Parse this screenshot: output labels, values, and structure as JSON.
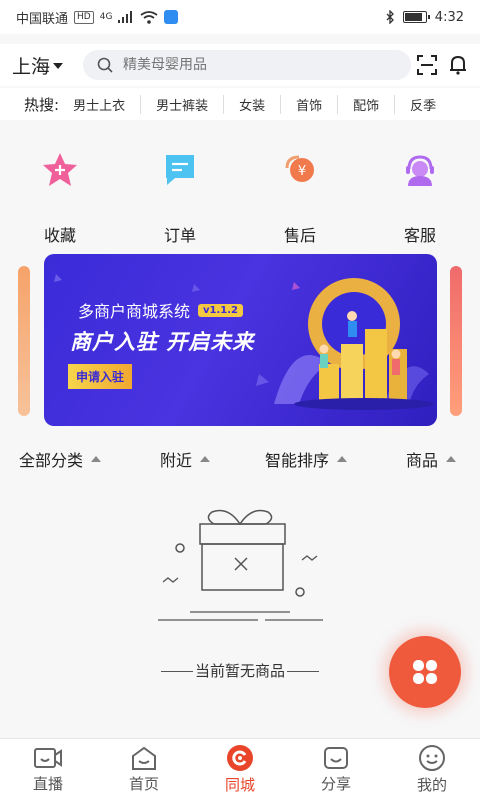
{
  "status": {
    "carrier": "中国联通",
    "net_badge": "HD",
    "net_type": "4G",
    "time": "4:32",
    "battery_level": 0.9
  },
  "header": {
    "city": "上海",
    "search_placeholder": "精美母婴用品"
  },
  "hot_search": {
    "label": "热搜:",
    "tags": [
      "男士上衣",
      "男士裤装",
      "女装",
      "首饰",
      "配饰",
      "反季"
    ]
  },
  "quick_links": [
    {
      "label": "收藏",
      "icon": "star-icon",
      "color": "#f0609a"
    },
    {
      "label": "订单",
      "icon": "order-icon",
      "color": "#4cc3f0"
    },
    {
      "label": "售后",
      "icon": "after-sale-icon",
      "color": "#f07a4c"
    },
    {
      "label": "客服",
      "icon": "customer-service-icon",
      "color": "#b06af0"
    }
  ],
  "banner": {
    "title": "多商户商城系统",
    "version": "v1.1.2",
    "slogan": "商户入驻  开启未来",
    "button": "申请入驻"
  },
  "filters": [
    {
      "label": "全部分类"
    },
    {
      "label": "附近"
    },
    {
      "label": "智能排序"
    },
    {
      "label": "商品"
    }
  ],
  "empty_state": {
    "text": "当前暂无商品"
  },
  "bottom_nav": [
    {
      "label": "直播",
      "icon": "live-icon",
      "active": false
    },
    {
      "label": "首页",
      "icon": "home-icon",
      "active": false
    },
    {
      "label": "同城",
      "icon": "local-city-icon",
      "active": true
    },
    {
      "label": "分享",
      "icon": "share-icon",
      "active": false
    },
    {
      "label": "我的",
      "icon": "profile-icon",
      "active": false
    }
  ],
  "colors": {
    "accent": "#e8452a",
    "fab": "#f05a3c",
    "banner": "#3a2bd8"
  }
}
